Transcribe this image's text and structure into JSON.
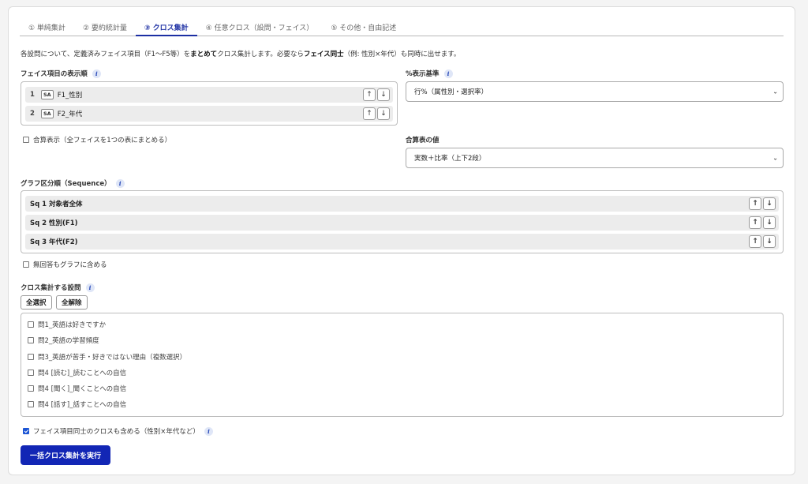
{
  "tabs": [
    {
      "label": "① 単純集計"
    },
    {
      "label": "② 要約統計量"
    },
    {
      "label": "③ クロス集計"
    },
    {
      "label": "④ 任意クロス（設問・フェイス）"
    },
    {
      "label": "⑤ その他・自由記述"
    }
  ],
  "description": {
    "part1": "各設問について、定義済みフェイス項目（F1〜F5等）を",
    "bold1": "まとめて",
    "part2": "クロス集計します。必要なら",
    "bold2": "フェイス同士",
    "part3": "（例: 性別×年代）も同時に出せます。"
  },
  "face_order": {
    "label": "フェイス項目の表示順",
    "items": [
      {
        "num": "1",
        "badge": "SA",
        "label": "F1_性別"
      },
      {
        "num": "2",
        "badge": "SA",
        "label": "F2_年代"
      }
    ]
  },
  "percent_base": {
    "label": "%表示基準",
    "value": "行%（属性別・選択率）"
  },
  "combined_display": {
    "label": "合算表示（全フェイスを1つの表にまとめる）",
    "checked": false
  },
  "combined_value": {
    "label": "合算表の値",
    "value": "実数＋比率（上下2段）"
  },
  "sequence": {
    "label": "グラフ区分順（Sequence）",
    "items": [
      {
        "label": "Sq 1  対象者全体"
      },
      {
        "label": "Sq 2  性別(F1)"
      },
      {
        "label": "Sq 3  年代(F2)"
      }
    ]
  },
  "include_no_answer": {
    "label": "無回答もグラフに含める",
    "checked": false
  },
  "questions": {
    "label": "クロス集計する設問",
    "select_all": "全選択",
    "clear_all": "全解除",
    "items": [
      {
        "label": "問1_英語は好きですか"
      },
      {
        "label": "問2_英語の学習頻度"
      },
      {
        "label": "問3_英語が苦手・好きではない理由（複数選択）"
      },
      {
        "label": "問4 [読む]_読むことへの自信"
      },
      {
        "label": "問4 [聞く]_聞くことへの自信"
      },
      {
        "label": "問4 [話す]_話すことへの自信"
      }
    ]
  },
  "face_cross": {
    "label": "フェイス項目同士のクロスも含める（性別×年代など）",
    "checked": true
  },
  "run_button": "一括クロス集計を実行",
  "arrows": {
    "up": "↑",
    "down": "↓"
  },
  "info_glyph": "i",
  "chevron": "⌄",
  "colors": {
    "accent": "#1c2fa3",
    "button": "#1226b5",
    "checkbox": "#1c55d4"
  }
}
